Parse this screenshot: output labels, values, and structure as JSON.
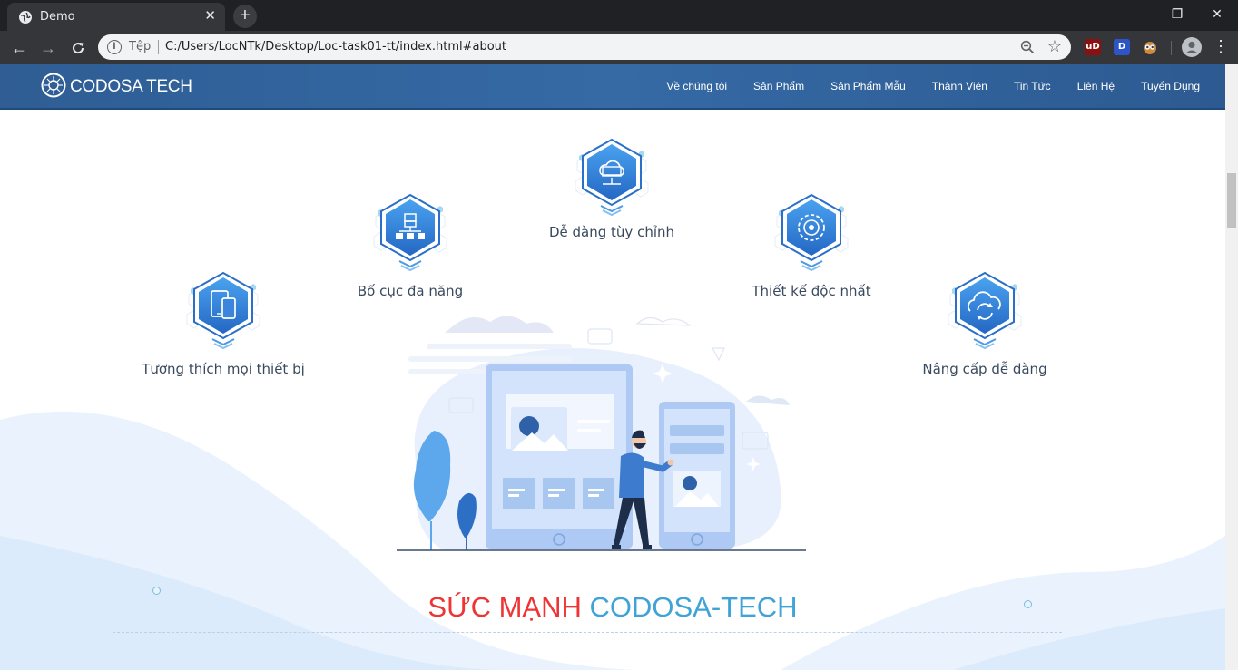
{
  "browser": {
    "tab_title": "Demo",
    "tab_close": "✕",
    "new_tab": "+",
    "window_controls": {
      "minimize": "—",
      "maximize": "❐",
      "close": "✕"
    },
    "scheme_label": "Tệp",
    "url": "C:/Users/LocNTk/Desktop/Loc-task01-tt/index.html#about",
    "extensions": [
      "uD",
      "D"
    ]
  },
  "site": {
    "logo_text": "CODOSA TECH",
    "nav": [
      "Về chúng tôi",
      "Sản Phẩm",
      "Sản Phẩm Mẫu",
      "Thành Viên",
      "Tin Tức",
      "Liên Hệ",
      "Tuyển Dụng"
    ]
  },
  "features": [
    {
      "label": "Dễ dàng tùy chỉnh",
      "icon": "cloud-code-icon"
    },
    {
      "label": "Bố cục đa năng",
      "icon": "layout-hierarchy-icon"
    },
    {
      "label": "Thiết kế độc nhất",
      "icon": "gear-target-icon"
    },
    {
      "label": "Tương thích mọi thiết bị",
      "icon": "devices-icon"
    },
    {
      "label": "Nâng cấp dễ dàng",
      "icon": "cloud-sync-icon"
    }
  ],
  "section": {
    "title_red": "SỨC MẠNH",
    "title_blue": "CODOSA-TECH"
  },
  "colors": {
    "header": "#356aa5",
    "title_red": "#ee3434",
    "title_blue": "#3fa3d8",
    "hex_icon": "#2f7fd6"
  }
}
